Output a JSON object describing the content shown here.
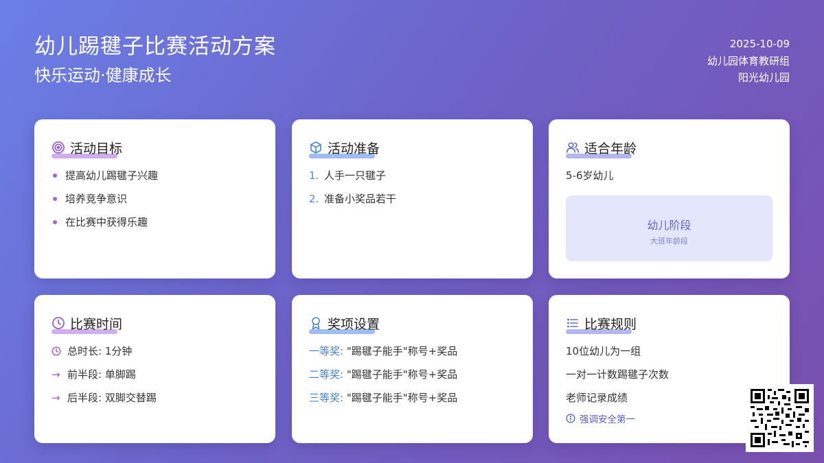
{
  "header": {
    "title": "幼儿踢毽子比赛活动方案",
    "subtitle": "快乐运动·健康成长",
    "date": "2025-10-09",
    "organizer": "幼儿园体育教研组",
    "school": "阳光幼儿园"
  },
  "cards": {
    "goals": {
      "title": "活动目标",
      "items": [
        "提高幼儿踢毽子兴趣",
        "培养竞争意识",
        "在比赛中获得乐趣"
      ]
    },
    "prep": {
      "title": "活动准备",
      "items": [
        {
          "num": "1.",
          "text": "人手一只毽子"
        },
        {
          "num": "2.",
          "text": "准备小奖品若干"
        }
      ]
    },
    "age": {
      "title": "适合年龄",
      "text": "5-6岁幼儿",
      "box_main": "幼儿阶段",
      "box_sub": "大班年龄段"
    },
    "time": {
      "title": "比赛时间",
      "items": [
        "总时长: 1分钟",
        "前半段: 单脚踢",
        "后半段: 双脚交替踢"
      ]
    },
    "awards": {
      "title": "奖项设置",
      "items": [
        {
          "label": "一等奖:",
          "text": "\"踢毽子能手\"称号+奖品"
        },
        {
          "label": "二等奖:",
          "text": "\"踢毽子能手\"称号+奖品"
        },
        {
          "label": "三等奖:",
          "text": "\"踢毽子能手\"称号+奖品"
        }
      ]
    },
    "rules": {
      "title": "比赛规则",
      "items": [
        "10位幼儿为一组",
        "一对一计数踢毽子次数",
        "老师记录成绩"
      ],
      "tip": "强调安全第一"
    }
  },
  "icons": {
    "goals": "target-icon",
    "prep": "box-icon",
    "age": "users-icon",
    "time": "clock-icon",
    "awards": "award-icon",
    "rules": "list-icon",
    "tip": "info-icon"
  },
  "colors": {
    "purple_accent": "#9b6ad0",
    "blue_accent": "#4a82d6",
    "indigo_accent": "#5b5fc6"
  }
}
